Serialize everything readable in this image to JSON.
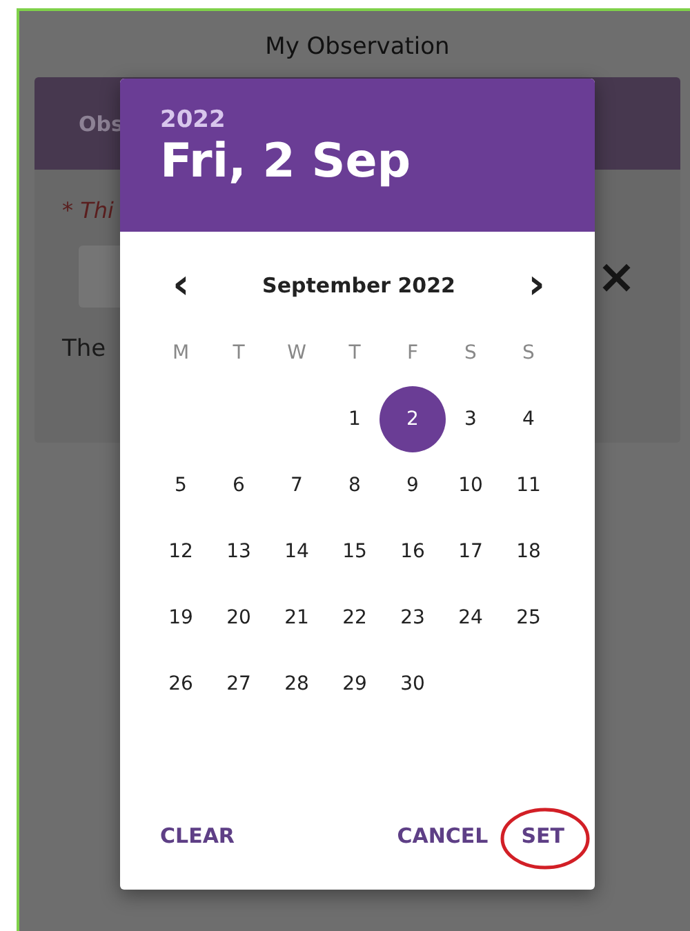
{
  "page": {
    "title": "My Observation"
  },
  "card": {
    "header": "Obs",
    "required_note": "* Thi",
    "close": "×",
    "text": "The"
  },
  "date_picker": {
    "year": "2022",
    "date": "Fri, 2 Sep",
    "month": "September 2022",
    "prev": "‹",
    "next": "›",
    "weekdays": [
      "M",
      "T",
      "W",
      "T",
      "F",
      "S",
      "S"
    ],
    "weeks": [
      {
        "kind": "first",
        "days": [
          {
            "label": "1",
            "selected": false
          },
          {
            "label": "2",
            "selected": true
          },
          {
            "label": "3",
            "selected": false
          },
          {
            "label": "4",
            "selected": false
          }
        ]
      },
      {
        "kind": "full",
        "days": [
          {
            "label": "5",
            "selected": false
          },
          {
            "label": "6",
            "selected": false
          },
          {
            "label": "7",
            "selected": false
          },
          {
            "label": "8",
            "selected": false
          },
          {
            "label": "9",
            "selected": false
          },
          {
            "label": "10",
            "selected": false
          },
          {
            "label": "11",
            "selected": false
          }
        ]
      },
      {
        "kind": "full",
        "days": [
          {
            "label": "12",
            "selected": false
          },
          {
            "label": "13",
            "selected": false
          },
          {
            "label": "14",
            "selected": false
          },
          {
            "label": "15",
            "selected": false
          },
          {
            "label": "16",
            "selected": false
          },
          {
            "label": "17",
            "selected": false
          },
          {
            "label": "18",
            "selected": false
          }
        ]
      },
      {
        "kind": "full",
        "days": [
          {
            "label": "19",
            "selected": false
          },
          {
            "label": "20",
            "selected": false
          },
          {
            "label": "21",
            "selected": false
          },
          {
            "label": "22",
            "selected": false
          },
          {
            "label": "23",
            "selected": false
          },
          {
            "label": "24",
            "selected": false
          },
          {
            "label": "25",
            "selected": false
          }
        ]
      },
      {
        "kind": "last",
        "days": [
          {
            "label": "26",
            "selected": false
          },
          {
            "label": "27",
            "selected": false
          },
          {
            "label": "28",
            "selected": false
          },
          {
            "label": "29",
            "selected": false
          },
          {
            "label": "30",
            "selected": false
          }
        ]
      }
    ],
    "buttons": [
      {
        "label": "CLEAR",
        "highlighted": false
      },
      {
        "label": "CANCEL",
        "highlighted": false
      },
      {
        "label": "SET",
        "highlighted": true
      }
    ]
  }
}
